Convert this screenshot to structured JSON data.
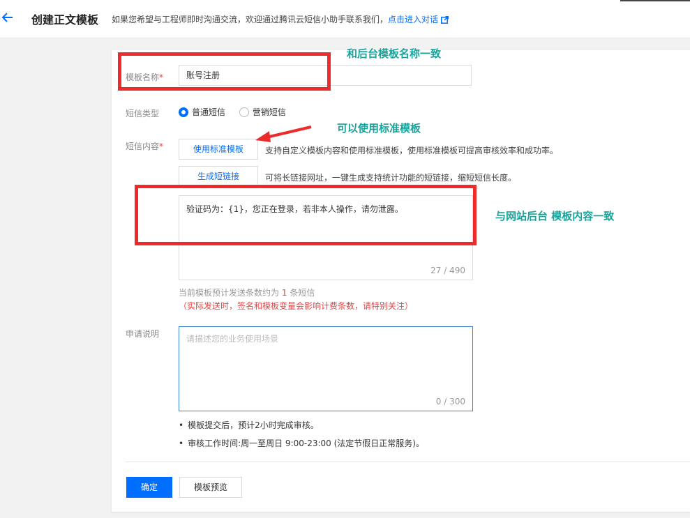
{
  "header": {
    "title": "创建正文模板",
    "subtitle": "如果您希望与工程师即时沟通交流，欢迎通过腾讯云短信小助手联系我们，",
    "link": "点击进入对话"
  },
  "form": {
    "name_label": "模板名称",
    "required_mark": "*",
    "name_value": "账号注册",
    "type_label": "短信类型",
    "type_options": [
      "普通短信",
      "营销短信"
    ],
    "content_label": "短信内容",
    "std_template_btn": "使用标准模板",
    "std_template_hint": "支持自定义模板内容和使用标准模板，使用标准模板可提高审核效率和成功率。",
    "short_link_btn": "生成短链接",
    "short_link_hint": "可将长链接网址，一键生成支持统计功能的短链接，缩短短信长度。",
    "content_value": "验证码为：{1}，您正在登录，若非本人操作，请勿泄露。",
    "content_counter": "27 / 490",
    "count_prefix": "当前模板预计发送条数约为",
    "count_num": "1",
    "count_suffix": "条短信",
    "count_warning": "（实际发送时，签名和模板变量会影响计费条数，请特别关注）",
    "desc_label": "申请说明",
    "desc_placeholder": "请描述您的业务使用场景",
    "desc_counter": "0 / 300",
    "tips": [
      "模板提交后，预计2小时完成审核。",
      "审核工作时间:周一至周日 9:00-23:00 (法定节假日正常服务)。"
    ],
    "confirm_btn": "确定",
    "preview_btn": "模板预览"
  },
  "annotations": {
    "note_name": "和后台模板名称一致",
    "note_std": "可以使用标准模板",
    "note_content": "与网站后台 模板内容一致"
  },
  "colors": {
    "primary": "#006eff",
    "annotation_red": "#ee2b2b",
    "annotation_teal": "#1aa39a",
    "warning": "#e54545"
  }
}
